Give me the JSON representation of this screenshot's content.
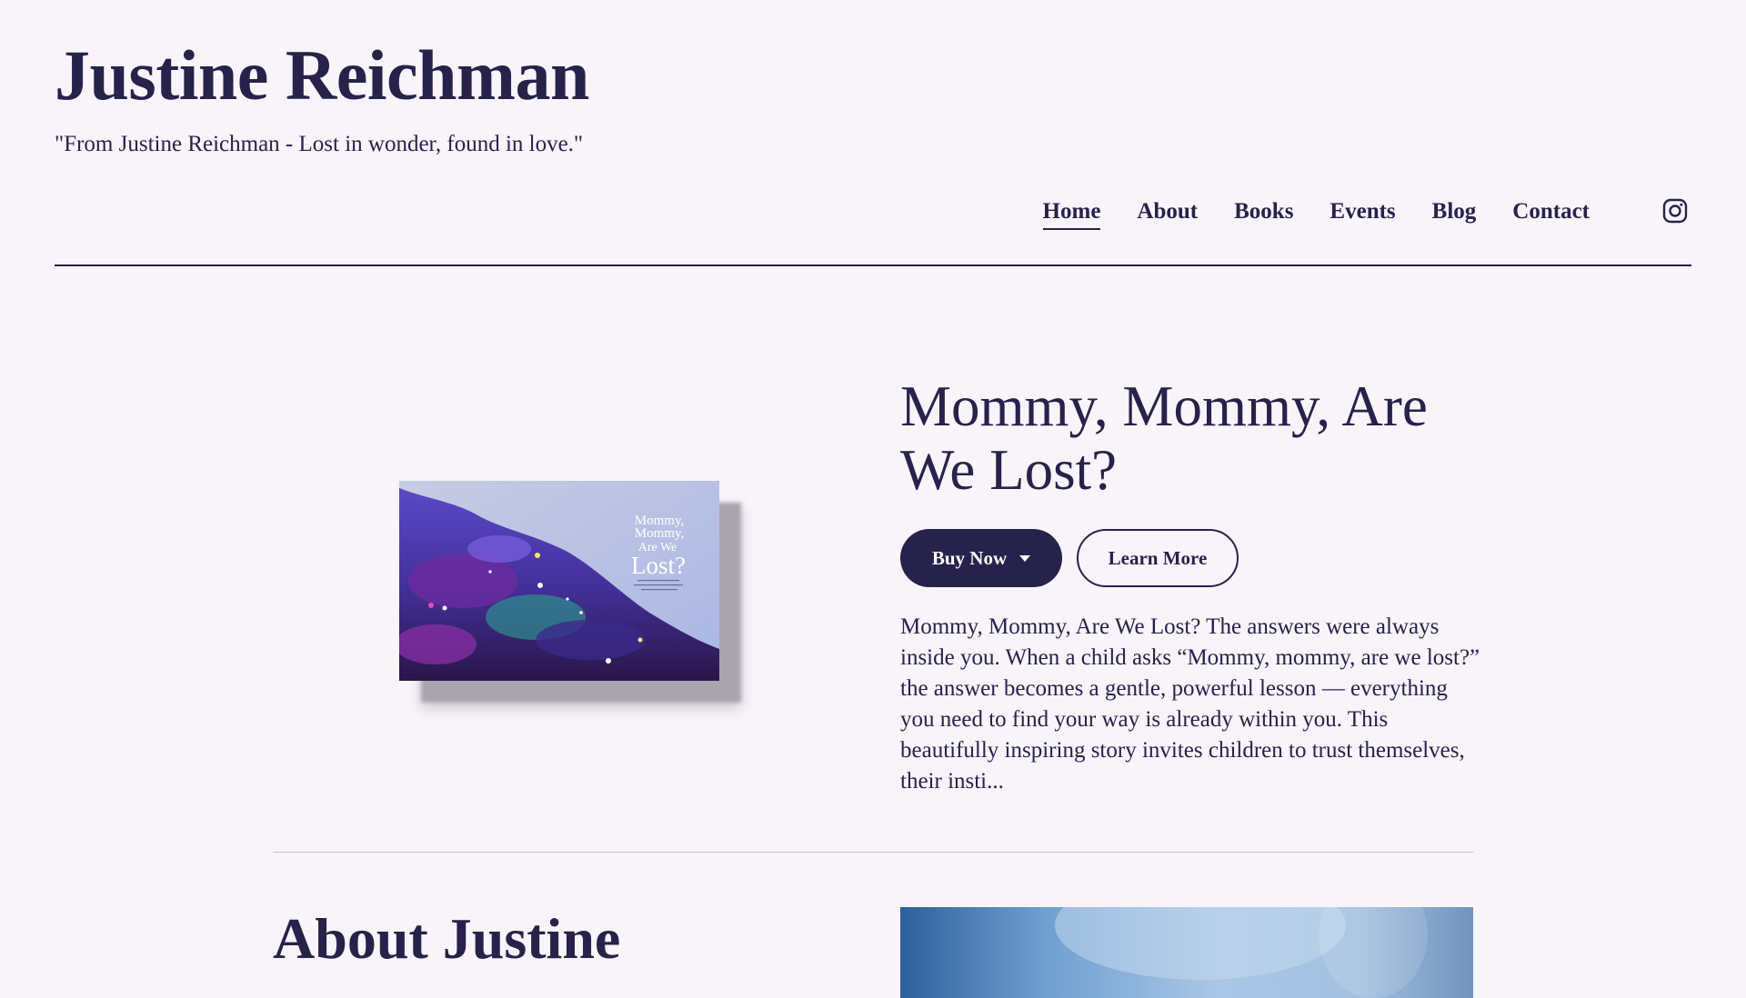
{
  "header": {
    "site_title": "Justine Reichman",
    "tagline": "\"From Justine Reichman - Lost in wonder, found in love.\"",
    "nav": [
      {
        "label": "Home",
        "active": true
      },
      {
        "label": "About",
        "active": false
      },
      {
        "label": "Books",
        "active": false
      },
      {
        "label": "Events",
        "active": false
      },
      {
        "label": "Blog",
        "active": false
      },
      {
        "label": "Contact",
        "active": false
      }
    ],
    "social_icon": "instagram-icon"
  },
  "featured_book": {
    "title": "Mommy, Mommy, Are We Lost?",
    "cover_title_lines": [
      "Mommy,",
      "Mommy,",
      "Are We",
      "Lost?"
    ],
    "buy_label": "Buy Now",
    "learn_label": "Learn More",
    "description": "Mommy, Mommy, Are We Lost? The answers were always inside you. When a child asks “Mommy, mommy, are we lost?” the answer becomes a gentle, powerful lesson — everything you need to find your way is already within you. This beautifully inspiring story invites children to trust themselves, their insti..."
  },
  "about": {
    "heading": "About Justine"
  },
  "colors": {
    "background": "#f8f4fa",
    "text": "#26224a",
    "button_primary": "#26224a"
  }
}
